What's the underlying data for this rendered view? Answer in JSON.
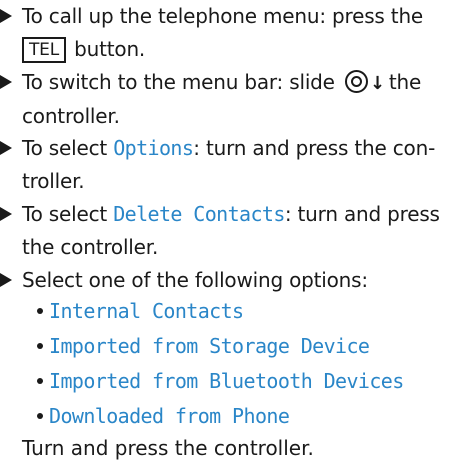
{
  "steps": [
    {
      "pre": "To call up the telephone menu: press the",
      "key": "TEL",
      "post": " button."
    },
    {
      "pre": "To switch to the menu bar: slide ",
      "icon": "controller-slide-down-icon",
      "arrow": "↓",
      "post": "the controller."
    },
    {
      "pre": "To select ",
      "mono": "Options",
      "post": ": turn and press the con-troller."
    },
    {
      "pre": "To select ",
      "mono": "Delete Contacts",
      "post": ": turn and press the controller."
    },
    {
      "pre": "Select one of the following options:"
    }
  ],
  "options": [
    "Internal Contacts",
    "Imported from Storage Device",
    "Imported from Bluetooth Devices",
    "Downloaded from Phone"
  ],
  "final": "Turn and press the controller.",
  "colors": {
    "accent": "#2a86c8",
    "text": "#1a1a1a"
  }
}
